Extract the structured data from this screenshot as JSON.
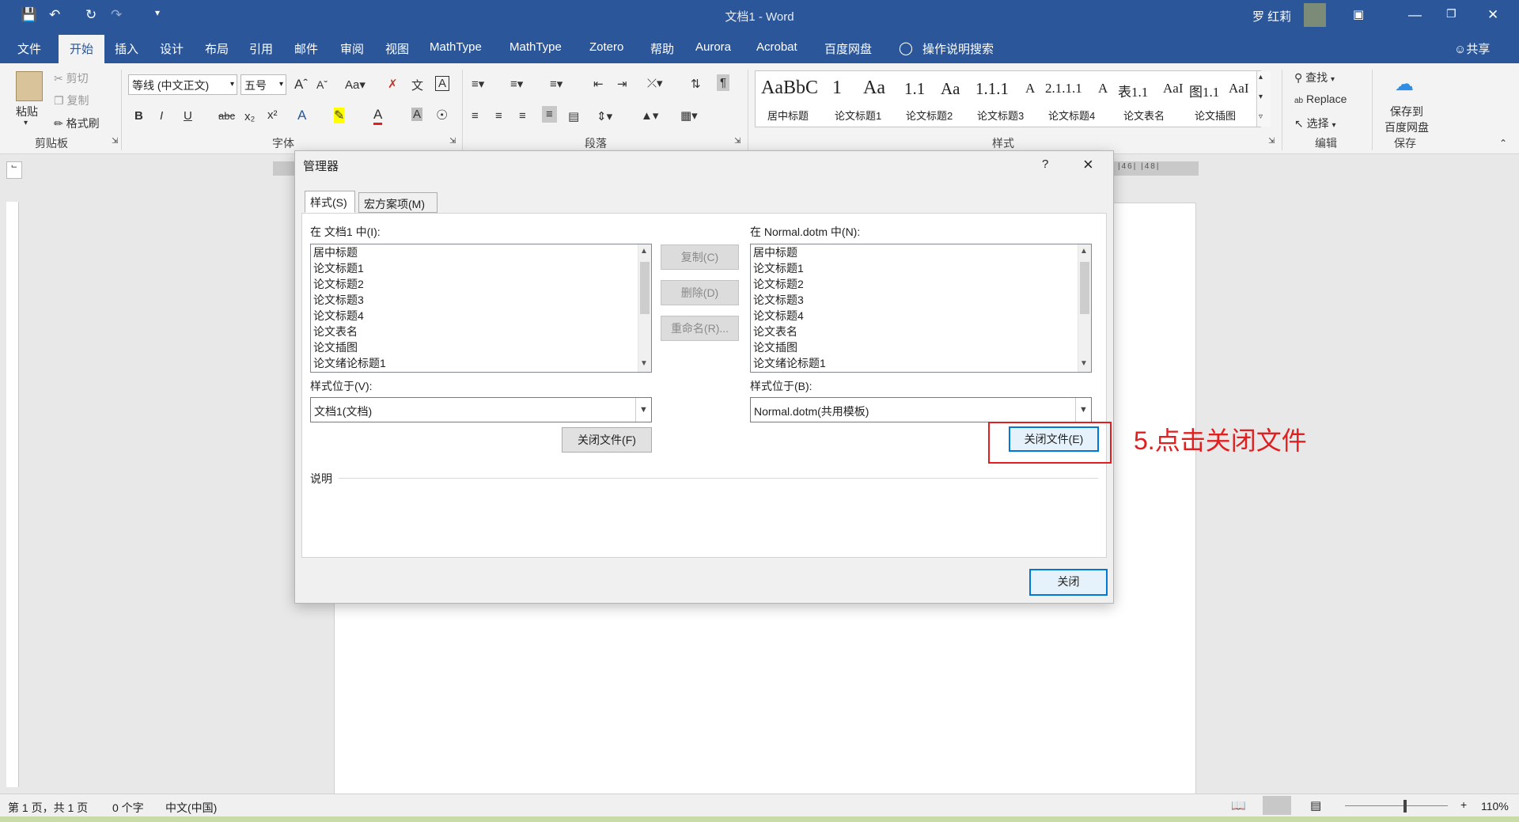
{
  "window": {
    "title": "文档1 - Word",
    "user": "罗 红莉"
  },
  "menu": [
    "文件",
    "开始",
    "插入",
    "设计",
    "布局",
    "引用",
    "邮件",
    "审阅",
    "视图",
    "MathType",
    "MathType",
    "Zotero",
    "帮助",
    "Aurora",
    "Acrobat",
    "百度网盘",
    "操作说明搜索"
  ],
  "menu_active": "开始",
  "share": "共享",
  "ribbon": {
    "paste": "粘贴",
    "cut": "剪切",
    "copy": "复制",
    "format_painter": "格式刷",
    "font_name": "等线 (中文正文)",
    "font_size": "五号",
    "groups": {
      "clipboard": "剪贴板",
      "font": "字体",
      "paragraph": "段落",
      "styles": "样式",
      "editing": "编辑",
      "save": "保存"
    },
    "find": "查找",
    "replace": "Replace",
    "select": "选择",
    "save_baidu": "保存到\n百度网盘",
    "save_baidu_1": "保存到",
    "save_baidu_2": "百度网盘"
  },
  "styles": [
    {
      "preview": "AaBbC",
      "name": "居中标题"
    },
    {
      "preview": "1",
      "name": "论文标题1"
    },
    {
      "preview": "Aa",
      "name": "论文标题2"
    },
    {
      "preview": "1.1",
      "name": "论文标题3"
    },
    {
      "preview": "Aa",
      "name": "论文标题4"
    },
    {
      "preview": "1.1.1",
      "name": "论文表名"
    },
    {
      "preview": "A",
      "name": "论文插图"
    }
  ],
  "style_previews_row": [
    "AaBbC",
    "1",
    "Aa",
    "1.1",
    "Aa",
    "1.1.1",
    "A",
    "2.1.1.1",
    "A",
    "表1.1",
    "AaI",
    "图1.1",
    "AaI"
  ],
  "style_names_row": [
    "居中标题",
    "论文标题1",
    "论文标题2",
    "论文标题3",
    "论文标题4",
    "论文表名",
    "论文插图"
  ],
  "dialog": {
    "title": "管理器",
    "help": "?",
    "close_x": "×",
    "tabs": [
      "样式(S)",
      "宏方案项(M)"
    ],
    "left_label": "在 文档1 中(I):",
    "right_label": "在 Normal.dotm 中(N):",
    "left_items": [
      "居中标题",
      "论文标题1",
      "论文标题2",
      "论文标题3",
      "论文标题4",
      "论文表名",
      "论文插图",
      "论文绪论标题1"
    ],
    "right_items": [
      "居中标题",
      "论文标题1",
      "论文标题2",
      "论文标题3",
      "论文标题4",
      "论文表名",
      "论文插图",
      "论文绪论标题1"
    ],
    "copy_btn": "复制(C)",
    "delete_btn": "删除(D)",
    "rename_btn": "重命名(R)...",
    "left_loc_label": "样式位于(V):",
    "left_loc_value": "文档1(文档)",
    "right_loc_label": "样式位于(B):",
    "right_loc_value": "Normal.dotm(共用模板)",
    "left_close_file": "关闭文件(F)",
    "right_close_file": "关闭文件(E)",
    "description_label": "说明",
    "close_btn": "关闭"
  },
  "annotation": "5.点击关闭文件",
  "status": {
    "page": "第 1 页，共 1 页",
    "words": "0 个字",
    "language": "中文(中国)",
    "zoom": "110%"
  },
  "colors": {
    "word_blue": "#2b579a",
    "annotation_red": "#e02020",
    "focus_blue": "#0078d7"
  }
}
